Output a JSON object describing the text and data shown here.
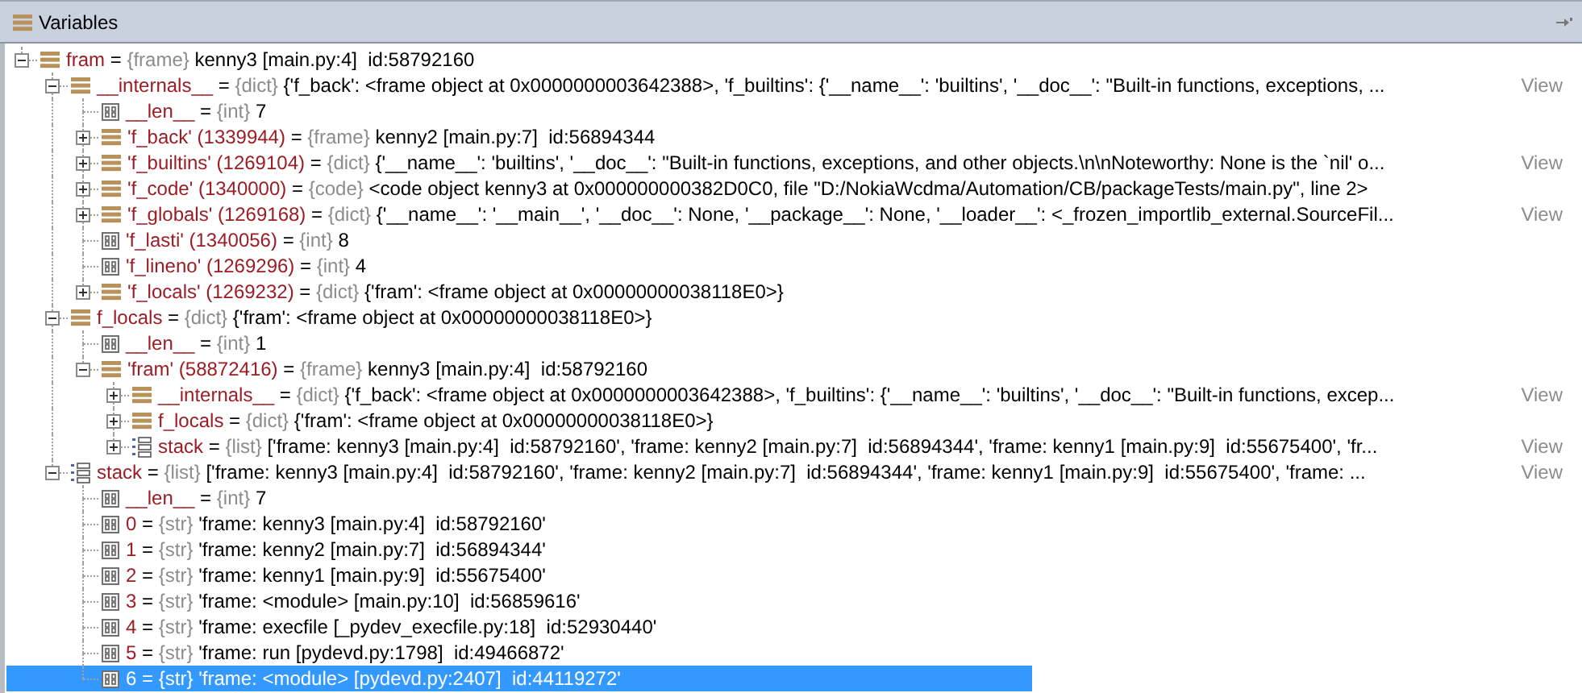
{
  "panel": {
    "title": "Variables"
  },
  "tree": [
    {
      "name": "fram",
      "separator": "=",
      "type": "{frame}",
      "value": "kenny3 [main.py:4]  id:58792160",
      "kind": "object",
      "expanded": true,
      "selected": false,
      "children": [
        {
          "name": "__internals__",
          "separator": "=",
          "type": "{dict}",
          "value": "{'f_back': <frame object at 0x0000000003642388>, 'f_builtins': {'__name__': 'builtins', '__doc__': \"Built-in functions, exceptions, ...",
          "view": "View",
          "kind": "object",
          "expanded": true,
          "selected": false,
          "children": [
            {
              "name": "__len__",
              "separator": "=",
              "type": "{int}",
              "value": "7",
              "kind": "primitive",
              "selected": false
            },
            {
              "name": "'f_back' (1339944)",
              "separator": "=",
              "type": "{frame}",
              "value": "kenny2 [main.py:7]  id:56894344",
              "kind": "object",
              "expanded": false,
              "selected": false
            },
            {
              "name": "'f_builtins' (1269104)",
              "separator": "=",
              "type": "{dict}",
              "value": "{'__name__': 'builtins', '__doc__': \"Built-in functions, exceptions, and other objects.\\n\\nNoteworthy: None is the `nil' o...",
              "view": "View",
              "kind": "object",
              "expanded": false,
              "selected": false
            },
            {
              "name": "'f_code' (1340000)",
              "separator": "=",
              "type": "{code}",
              "value": "<code object kenny3 at 0x000000000382D0C0, file \"D:/NokiaWcdma/Automation/CB/packageTests/main.py\", line 2>",
              "kind": "object",
              "expanded": false,
              "selected": false
            },
            {
              "name": "'f_globals' (1269168)",
              "separator": "=",
              "type": "{dict}",
              "value": "{'__name__': '__main__', '__doc__': None, '__package__': None, '__loader__': <_frozen_importlib_external.SourceFil...",
              "view": "View",
              "kind": "object",
              "expanded": false,
              "selected": false
            },
            {
              "name": "'f_lasti' (1340056)",
              "separator": "=",
              "type": "{int}",
              "value": "8",
              "kind": "primitive",
              "selected": false
            },
            {
              "name": "'f_lineno' (1269296)",
              "separator": "=",
              "type": "{int}",
              "value": "4",
              "kind": "primitive",
              "selected": false
            },
            {
              "name": "'f_locals' (1269232)",
              "separator": "=",
              "type": "{dict}",
              "value": "{'fram': <frame object at 0x00000000038118E0>}",
              "kind": "object",
              "expanded": false,
              "selected": false
            }
          ]
        },
        {
          "name": "f_locals",
          "separator": "=",
          "type": "{dict}",
          "value": "{'fram': <frame object at 0x00000000038118E0>}",
          "kind": "object",
          "expanded": true,
          "selected": false,
          "children": [
            {
              "name": "__len__",
              "separator": "=",
              "type": "{int}",
              "value": "1",
              "kind": "primitive",
              "selected": false
            },
            {
              "name": "'fram' (58872416)",
              "separator": "=",
              "type": "{frame}",
              "value": "kenny3 [main.py:4]  id:58792160",
              "kind": "object",
              "expanded": true,
              "selected": false,
              "children": [
                {
                  "name": "__internals__",
                  "separator": "=",
                  "type": "{dict}",
                  "value": "{'f_back': <frame object at 0x0000000003642388>, 'f_builtins': {'__name__': 'builtins', '__doc__': \"Built-in functions, excep...",
                  "view": "View",
                  "kind": "object",
                  "expanded": false,
                  "selected": false
                },
                {
                  "name": "f_locals",
                  "separator": "=",
                  "type": "{dict}",
                  "value": "{'fram': <frame object at 0x00000000038118E0>}",
                  "kind": "object",
                  "expanded": false,
                  "selected": false
                },
                {
                  "name": "stack",
                  "separator": "=",
                  "type": "{list}",
                  "value": "['frame: kenny3 [main.py:4]  id:58792160', 'frame: kenny2 [main.py:7]  id:56894344', 'frame: kenny1 [main.py:9]  id:55675400', 'fr...",
                  "view": "View",
                  "kind": "list",
                  "expanded": false,
                  "selected": false
                }
              ]
            }
          ]
        },
        {
          "name": "stack",
          "separator": "=",
          "type": "{list}",
          "value": "['frame: kenny3 [main.py:4]  id:58792160', 'frame: kenny2 [main.py:7]  id:56894344', 'frame: kenny1 [main.py:9]  id:55675400', 'frame: ...",
          "view": "View",
          "kind": "list",
          "expanded": true,
          "selected": false,
          "children": [
            {
              "name": "__len__",
              "separator": "=",
              "type": "{int}",
              "value": "7",
              "kind": "primitive",
              "selected": false
            },
            {
              "name": "0",
              "separator": "=",
              "type": "{str}",
              "value": "'frame: kenny3 [main.py:4]  id:58792160'",
              "kind": "primitive",
              "selected": false
            },
            {
              "name": "1",
              "separator": "=",
              "type": "{str}",
              "value": "'frame: kenny2 [main.py:7]  id:56894344'",
              "kind": "primitive",
              "selected": false
            },
            {
              "name": "2",
              "separator": "=",
              "type": "{str}",
              "value": "'frame: kenny1 [main.py:9]  id:55675400'",
              "kind": "primitive",
              "selected": false
            },
            {
              "name": "3",
              "separator": "=",
              "type": "{str}",
              "value": "'frame: <module> [main.py:10]  id:56859616'",
              "kind": "primitive",
              "selected": false
            },
            {
              "name": "4",
              "separator": "=",
              "type": "{str}",
              "value": "'frame: execfile [_pydev_execfile.py:18]  id:52930440'",
              "kind": "primitive",
              "selected": false
            },
            {
              "name": "5",
              "separator": "=",
              "type": "{str}",
              "value": "'frame: run [pydevd.py:1798]  id:49466872'",
              "kind": "primitive",
              "selected": false
            },
            {
              "name": "6",
              "separator": "=",
              "type": "{str}",
              "value": "'frame: <module> [pydevd.py:2407]  id:44119272'",
              "kind": "primitive",
              "selected": true
            }
          ]
        }
      ]
    }
  ]
}
